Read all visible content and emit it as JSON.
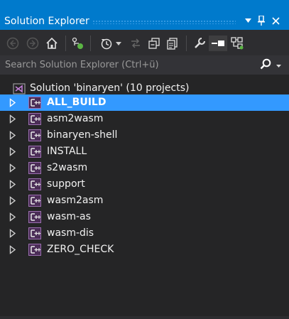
{
  "window": {
    "title": "Solution Explorer",
    "colors": {
      "title_bar": "#007acc",
      "background": "#252526",
      "selection": "#3399ff",
      "toolbar": "#2d2d30"
    }
  },
  "titlebar_buttons": [
    {
      "name": "dropdown-icon",
      "glyph": "▼"
    },
    {
      "name": "pin-icon",
      "glyph": "⊣"
    },
    {
      "name": "close-icon",
      "glyph": "✕"
    }
  ],
  "toolbar": {
    "icons": [
      "back-icon",
      "forward-icon",
      "home-icon",
      "sync-with-active-document-icon",
      "pending-changes-icon",
      "refresh-icon",
      "collapse-all-icon",
      "show-all-files-icon",
      "properties-icon",
      "preview-selected-items-icon",
      "class-view-icon"
    ]
  },
  "search": {
    "placeholder": "Search Solution Explorer (Ctrl+ü)"
  },
  "solution": {
    "label": "Solution 'binaryen' (10 projects)"
  },
  "projects": [
    {
      "label": "ALL_BUILD",
      "selected": true
    },
    {
      "label": "asm2wasm",
      "selected": false
    },
    {
      "label": "binaryen-shell",
      "selected": false
    },
    {
      "label": "INSTALL",
      "selected": false
    },
    {
      "label": "s2wasm",
      "selected": false
    },
    {
      "label": "support",
      "selected": false
    },
    {
      "label": "wasm2asm",
      "selected": false
    },
    {
      "label": "wasm-as",
      "selected": false
    },
    {
      "label": "wasm-dis",
      "selected": false
    },
    {
      "label": "ZERO_CHECK",
      "selected": false
    }
  ]
}
